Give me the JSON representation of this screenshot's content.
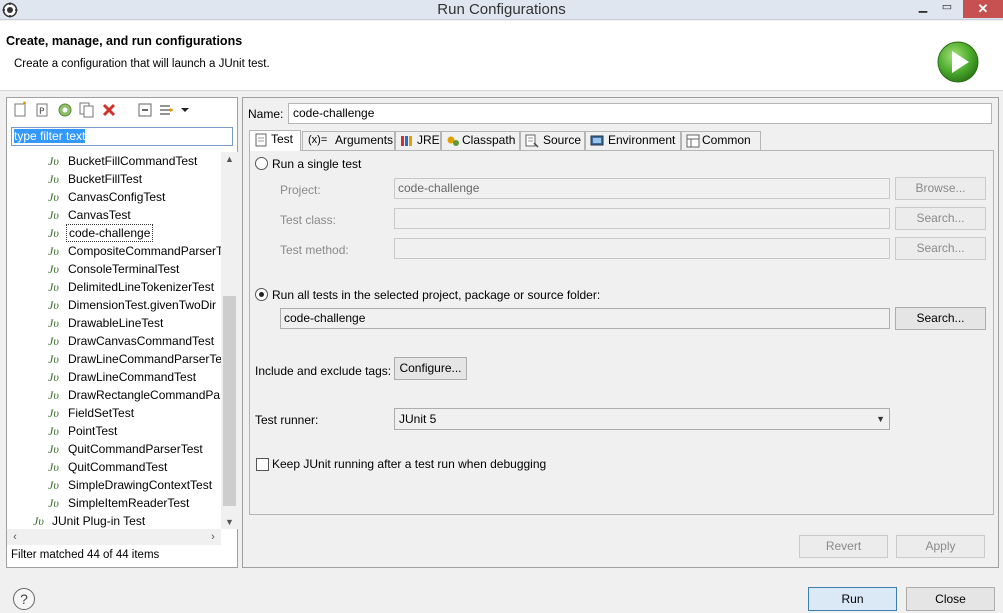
{
  "window": {
    "title": "Run Configurations",
    "minimize": "▁",
    "maximize": "▭",
    "close": "✕"
  },
  "header": {
    "title": "Create, manage, and run configurations",
    "description": "Create a configuration that will launch a JUnit test."
  },
  "left_panel": {
    "toolbar": [
      "new-configuration-icon",
      "new-prototype-icon",
      "export-icon",
      "duplicate-icon",
      "delete-icon",
      "collapse-all-icon",
      "filter-icon",
      "dropdown-icon"
    ],
    "filter_text": "type filter text",
    "tree_items": [
      "BucketFillCommandTest",
      "BucketFillTest",
      "CanvasConfigTest",
      "CanvasTest",
      "code-challenge",
      "CompositeCommandParserT",
      "ConsoleTerminalTest",
      "DelimitedLineTokenizerTest",
      "DimensionTest.givenTwoDir",
      "DrawableLineTest",
      "DrawCanvasCommandTest",
      "DrawLineCommandParserTe",
      "DrawLineCommandTest",
      "DrawRectangleCommandPa",
      "FieldSetTest",
      "PointTest",
      "QuitCommandParserTest",
      "QuitCommandTest",
      "SimpleDrawingContextTest",
      "SimpleItemReaderTest"
    ],
    "selected_item": "code-challenge",
    "plugin_item": "JUnit Plug-in Test",
    "junit_icon_text": "Jυ",
    "status": "Filter matched 44 of 44 items"
  },
  "right_panel": {
    "name_label": "Name:",
    "name_value": "code-challenge",
    "tabs": [
      {
        "label": "Test",
        "icon": "test-tab-icon"
      },
      {
        "label": "Arguments",
        "icon": "arguments-tab-icon"
      },
      {
        "label": "JRE",
        "icon": "jre-tab-icon"
      },
      {
        "label": "Classpath",
        "icon": "classpath-tab-icon"
      },
      {
        "label": "Source",
        "icon": "source-tab-icon"
      },
      {
        "label": "Environment",
        "icon": "environment-tab-icon"
      },
      {
        "label": "Common",
        "icon": "common-tab-icon"
      }
    ],
    "arguments_prefix": "(x)=",
    "active_tab": "Test",
    "test_tab": {
      "run_single_label": "Run a single test",
      "project_label": "Project:",
      "project_value": "code-challenge",
      "browse_label": "Browse...",
      "test_class_label": "Test class:",
      "test_class_value": "",
      "test_method_label": "Test method:",
      "test_method_value": "",
      "search_label": "Search...",
      "run_all_label": "Run all tests in the selected project, package or source folder:",
      "run_all_value": "code-challenge",
      "tags_label": "Include and exclude tags:",
      "configure_label": "Configure...",
      "runner_label": "Test runner:",
      "runner_value": "JUnit 5",
      "keep_running_label": "Keep JUnit running after a test run when debugging",
      "keep_running_checked": false,
      "run_single_selected": false,
      "run_all_selected": true
    },
    "revert_label": "Revert",
    "apply_label": "Apply"
  },
  "footer": {
    "help": "?",
    "run_label": "Run",
    "close_label": "Close"
  }
}
